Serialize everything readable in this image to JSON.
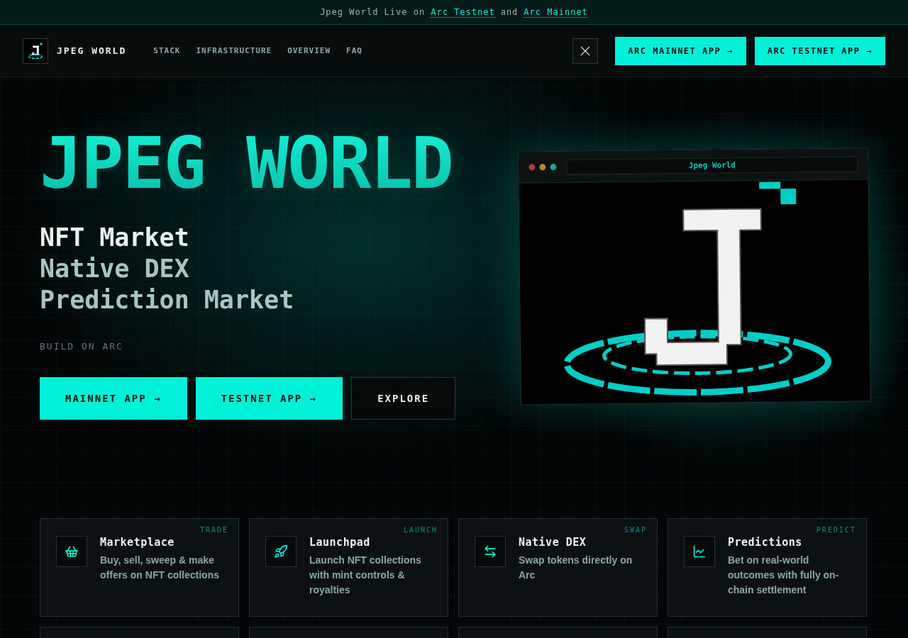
{
  "banner": {
    "text": "Jpeg World Live on",
    "link_1": "Arc Testnet",
    "joiner": "and",
    "link_2": "Arc Mainnet"
  },
  "nav": {
    "brand": "JPEG WORLD",
    "links": [
      "STACK",
      "INFRASTRUCTURE",
      "OVERVIEW",
      "FAQ"
    ],
    "buttons": [
      "ARC MAINNET APP →",
      "ARC TESTNET APP →"
    ]
  },
  "hero": {
    "title": "JPEG WORLD",
    "lines": [
      {
        "text": "NFT Market",
        "highlighted": true
      },
      {
        "text": "Native DEX",
        "highlighted": false
      },
      {
        "text": "Prediction Market",
        "highlighted": false
      }
    ],
    "tagline": "BUILD ON ARC",
    "buttons": [
      {
        "label": "MAINNET APP →",
        "kind": "primary"
      },
      {
        "label": "TESTNET APP →",
        "kind": "primary"
      },
      {
        "label": "EXPLORE",
        "kind": "outline"
      }
    ],
    "preview": {
      "title": "Jpeg World"
    }
  },
  "features": [
    {
      "tag": "TRADE",
      "title": "Marketplace",
      "description": "Buy, sell, sweep & make offers on NFT collections"
    },
    {
      "tag": "LAUNCH",
      "title": "Launchpad",
      "description": "Launch NFT collections with mint controls & royalties"
    },
    {
      "tag": "SWAP",
      "title": "Native DEX",
      "description": "Swap tokens directly on Arc"
    },
    {
      "tag": "PREDICT",
      "title": "Predictions",
      "description": "Bet on real-world outcomes with fully on-chain settlement"
    },
    {
      "kind": "cut"
    },
    {
      "kind": "cut"
    },
    {
      "kind": "cut"
    },
    {
      "kind": "cut"
    }
  ]
}
